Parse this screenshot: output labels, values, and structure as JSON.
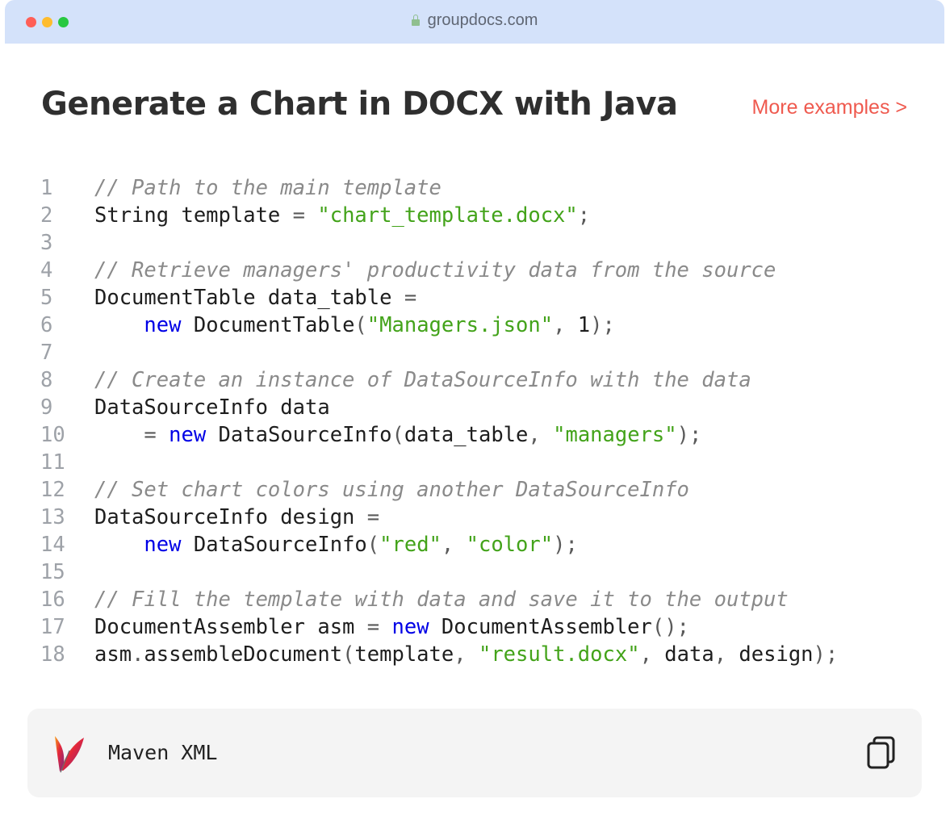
{
  "browser": {
    "url": "groupdocs.com"
  },
  "page": {
    "title": "Generate a Chart in DOCX with Java",
    "more_link": "More examples >"
  },
  "code": {
    "lines": [
      {
        "n": "1",
        "parts": [
          [
            "c",
            "// Path to the main template"
          ]
        ]
      },
      {
        "n": "2",
        "parts": [
          [
            "t",
            "String template "
          ],
          [
            "p",
            "= "
          ],
          [
            "s",
            "\"chart_template.docx\""
          ],
          [
            "p",
            ";"
          ]
        ]
      },
      {
        "n": "3",
        "parts": []
      },
      {
        "n": "4",
        "parts": [
          [
            "c",
            "// Retrieve managers' productivity data from the source"
          ]
        ]
      },
      {
        "n": "5",
        "parts": [
          [
            "t",
            "DocumentTable data_table "
          ],
          [
            "p",
            "="
          ]
        ]
      },
      {
        "n": "6",
        "parts": [
          [
            "t",
            "    "
          ],
          [
            "k",
            "new"
          ],
          [
            "t",
            " DocumentTable"
          ],
          [
            "p",
            "("
          ],
          [
            "s",
            "\"Managers.json\""
          ],
          [
            "p",
            ", "
          ],
          [
            "t",
            "1"
          ],
          [
            "p",
            ");"
          ]
        ]
      },
      {
        "n": "7",
        "parts": []
      },
      {
        "n": "8",
        "parts": [
          [
            "c",
            "// Create an instance of DataSourceInfo with the data"
          ]
        ]
      },
      {
        "n": "9",
        "parts": [
          [
            "t",
            "DataSourceInfo data"
          ]
        ]
      },
      {
        "n": "10",
        "parts": [
          [
            "t",
            "    "
          ],
          [
            "p",
            "= "
          ],
          [
            "k",
            "new"
          ],
          [
            "t",
            " DataSourceInfo"
          ],
          [
            "p",
            "("
          ],
          [
            "t",
            "data_table"
          ],
          [
            "p",
            ", "
          ],
          [
            "s",
            "\"managers\""
          ],
          [
            "p",
            ");"
          ]
        ]
      },
      {
        "n": "11",
        "parts": []
      },
      {
        "n": "12",
        "parts": [
          [
            "c",
            "// Set chart colors using another DataSourceInfo"
          ]
        ]
      },
      {
        "n": "13",
        "parts": [
          [
            "t",
            "DataSourceInfo design "
          ],
          [
            "p",
            "="
          ]
        ]
      },
      {
        "n": "14",
        "parts": [
          [
            "t",
            "    "
          ],
          [
            "k",
            "new"
          ],
          [
            "t",
            " DataSourceInfo"
          ],
          [
            "p",
            "("
          ],
          [
            "s",
            "\"red\""
          ],
          [
            "p",
            ", "
          ],
          [
            "s",
            "\"color\""
          ],
          [
            "p",
            ");"
          ]
        ]
      },
      {
        "n": "15",
        "parts": []
      },
      {
        "n": "16",
        "parts": [
          [
            "c",
            "// Fill the template with data and save it to the output"
          ]
        ]
      },
      {
        "n": "17",
        "parts": [
          [
            "t",
            "DocumentAssembler asm "
          ],
          [
            "p",
            "= "
          ],
          [
            "k",
            "new"
          ],
          [
            "t",
            " DocumentAssembler"
          ],
          [
            "p",
            "();"
          ]
        ]
      },
      {
        "n": "18",
        "parts": [
          [
            "t",
            "asm"
          ],
          [
            "p",
            "."
          ],
          [
            "t",
            "assembleDocument"
          ],
          [
            "p",
            "("
          ],
          [
            "t",
            "template"
          ],
          [
            "p",
            ", "
          ],
          [
            "s",
            "\"result.docx\""
          ],
          [
            "p",
            ", "
          ],
          [
            "t",
            "data"
          ],
          [
            "p",
            ", "
          ],
          [
            "t",
            "design"
          ],
          [
            "p",
            ");"
          ]
        ]
      }
    ]
  },
  "maven": {
    "label": "Maven XML",
    "icon": "apache-feather-icon",
    "copy_icon": "copy-icon"
  },
  "colors": {
    "titlebar": "#d4e2fa",
    "link": "#ef5a4f",
    "string": "#43a31a",
    "keyword": "#0000e6",
    "comment": "#8a8a8a"
  }
}
